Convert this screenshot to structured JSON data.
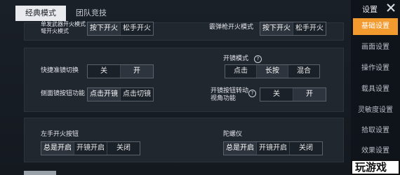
{
  "tabs": [
    {
      "label": "经典模式",
      "active": true
    },
    {
      "label": "团队竞技",
      "active": false
    }
  ],
  "panel1": {
    "left_label": "单发武器开火模式 弩开火模式",
    "left_options": [
      "按下开火",
      "松手开火"
    ],
    "right_label": "霰弹枪开火模式",
    "right_options": [
      "按下开火",
      "松手开火"
    ]
  },
  "panel2": {
    "quick_scope_label": "快捷准镜切换",
    "quick_scope_options": [
      "关",
      "开"
    ],
    "side_mirror_label": "侧面镜按钮功能",
    "side_mirror_options": [
      "点击开镜",
      "点击切镜"
    ],
    "scope_mode_label": "开镜模式",
    "scope_mode_options": [
      "点击",
      "长按",
      "混合"
    ],
    "scope_view_label": "开镜按钮转动视角功能",
    "scope_view_options": [
      "关",
      "开"
    ]
  },
  "panel3": {
    "left_fire_label": "左手开火按钮",
    "left_fire_options": [
      "总是开启",
      "开镜开启",
      "关闭"
    ],
    "gyro_label": "陀螺仪",
    "gyro_options": [
      "总是开启",
      "开镜开启",
      "关闭"
    ]
  },
  "sidebar": {
    "title": "设置",
    "items": [
      {
        "label": "基础设置",
        "active": true
      },
      {
        "label": "画面设置",
        "active": false
      },
      {
        "label": "操作设置",
        "active": false
      },
      {
        "label": "载具设置",
        "active": false
      },
      {
        "label": "灵敏度设置",
        "active": false
      },
      {
        "label": "拾取设置",
        "active": false
      },
      {
        "label": "效果设置",
        "active": false
      }
    ]
  },
  "watermark_text": "玩游戏",
  "icons": {
    "help": "question-circle-icon",
    "close": "close-x-icon"
  },
  "colors": {
    "accent": "#f29a2e",
    "panel": "#20272f",
    "sidebar": "#0f141a"
  }
}
